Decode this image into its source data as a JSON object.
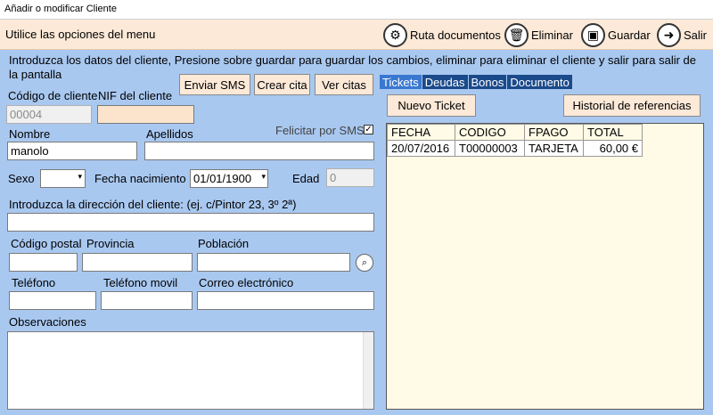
{
  "window": {
    "title": "Añadir o modificar Cliente"
  },
  "toolbar": {
    "hint": "Utilice las opciones del menu",
    "buttons": [
      {
        "label": "Ruta documentos",
        "icon": "gear-icon"
      },
      {
        "label": "Eliminar",
        "icon": "trash-icon"
      },
      {
        "label": "Guardar",
        "icon": "save-icon"
      },
      {
        "label": "Salir",
        "icon": "exit-icon"
      }
    ]
  },
  "intro": "Introduzca los datos del cliente, Presione sobre guardar para guardar los cambios, eliminar para eliminar el cliente y salir para salir de la pantalla",
  "actions": {
    "sms": "Enviar SMS",
    "cita": "Crear cita",
    "citas": "Ver citas"
  },
  "form": {
    "codigo_label": "Código de cliente",
    "codigo_value": "00004",
    "nif_label": "NIF del cliente",
    "nif_value": "",
    "felicitar_label": "Felicitar por SMS",
    "felicitar_checked": true,
    "nombre_label": "Nombre",
    "nombre_value": "manolo",
    "apellidos_label": "Apellidos",
    "apellidos_value": "",
    "sexo_label": "Sexo",
    "sexo_value": "",
    "fecha_label": "Fecha nacimiento",
    "fecha_value": "01/01/1900",
    "edad_label": "Edad",
    "edad_value": "0",
    "direccion_label": "Introduzca la dirección del cliente: (ej. c/Pintor 23, 3º 2ª)",
    "direccion_value": "",
    "cp_label": "Código postal",
    "provincia_label": "Provincia",
    "poblacion_label": "Población",
    "telefono_label": "Teléfono",
    "movil_label": "Teléfono movil",
    "email_label": "Correo electrónico",
    "observaciones_label": "Observaciones"
  },
  "tabs": [
    "Tickets",
    "Deudas",
    "Bonos",
    "Documento"
  ],
  "tickets": {
    "new_button": "Nuevo Ticket",
    "history_button": "Historial de referencias",
    "columns": [
      "FECHA",
      "CODIGO",
      "FPAGO",
      "TOTAL"
    ],
    "rows": [
      [
        "20/07/2016",
        "T00000003",
        "TARJETA",
        "60,00 €"
      ]
    ]
  }
}
